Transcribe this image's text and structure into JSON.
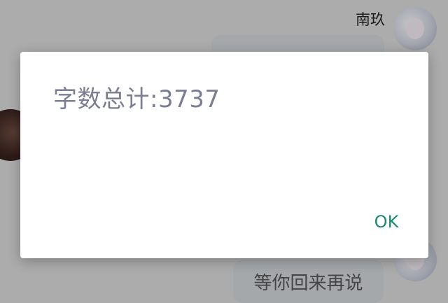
{
  "chat": {
    "sender_name": "南玖",
    "last_message": "等你回来再说"
  },
  "dialog": {
    "message": "字数总计:3737",
    "ok_label": "OK"
  },
  "colors": {
    "dialog_text": "#7b7d93",
    "ok_accent": "#1a8a73",
    "bubble": "#c9cdd1"
  },
  "icons": [
    "avatar-image-right-top",
    "avatar-image-left",
    "avatar-image-right-bottom"
  ]
}
